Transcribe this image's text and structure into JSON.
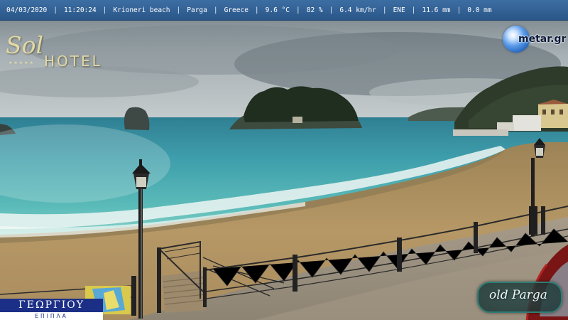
{
  "overlay": {
    "date": "04/03/2020",
    "time": "11:20:24",
    "location": "Krioneri beach",
    "town": "Parga",
    "country": "Greece",
    "temperature": "9.6 °C",
    "humidity": "82 %",
    "wind_speed": "6.4 km/hr",
    "wind_direction": "ENE",
    "rain_rate": "11.6 mm",
    "rain_total": "0.0 mm",
    "separator": "|"
  },
  "logos": {
    "sol_word": "Sol",
    "hotel_word": "HOTEL",
    "stars": "★★★★★",
    "metar": "metar.gr",
    "georgiou_top": "ΓΕΩΡΓΙΟΥ",
    "georgiou_bottom": "ΕΠΙΠΛΑ",
    "old_parga": "old Parga"
  },
  "colors": {
    "overlay_bar": "#2f5d91",
    "sea_turquoise": "#5ab8b7",
    "sand": "#b39563",
    "sky": "#9ea9ae"
  }
}
